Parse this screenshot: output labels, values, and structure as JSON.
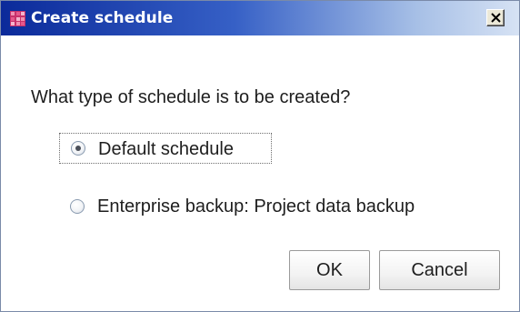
{
  "window": {
    "title": "Create schedule",
    "title_icon": "app-grid-icon",
    "close_label": "Close"
  },
  "dialog": {
    "question": "What type of schedule is to be created?",
    "options": [
      {
        "label": "Default schedule",
        "selected": true
      },
      {
        "label": "Enterprise backup: Project data backup",
        "selected": false
      }
    ]
  },
  "buttons": {
    "ok_label": "OK",
    "cancel_label": "Cancel"
  },
  "colors": {
    "titlebar_start": "#0b2a9a",
    "titlebar_end": "#d6e2f4",
    "title_icon": "#c8306a",
    "text": "#1e1e1e"
  }
}
